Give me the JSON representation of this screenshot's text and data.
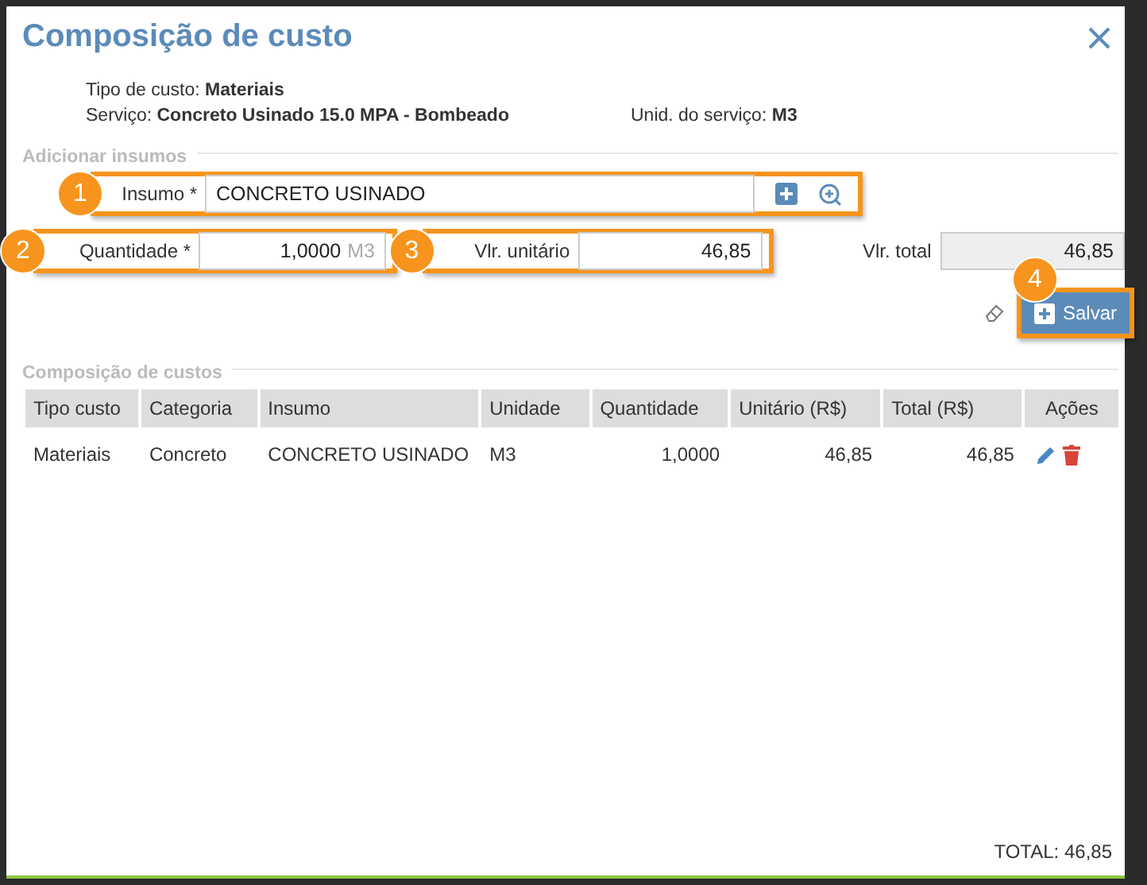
{
  "title": "Composição de custo",
  "info": {
    "cost_type_label": "Tipo de custo:",
    "cost_type": "Materiais",
    "service_label": "Serviço:",
    "service": "Concreto Usinado 15.0 MPA - Bombeado",
    "unit_label": "Unid. do serviço:",
    "unit": "M3"
  },
  "add_section": {
    "title": "Adicionar insumos",
    "insumo": {
      "callout": "1",
      "label": "Insumo *",
      "value": "CONCRETO USINADO"
    },
    "quantity": {
      "callout": "2",
      "label": "Quantidade *",
      "value": "1,0000",
      "unit": "M3"
    },
    "unit_value": {
      "callout": "3",
      "label": "Vlr. unitário",
      "value": "46,85"
    },
    "total_value": {
      "label": "Vlr. total",
      "value": "46,85"
    },
    "save": {
      "callout": "4",
      "label": "Salvar"
    }
  },
  "table": {
    "title": "Composição de custos",
    "columns": [
      "Tipo custo",
      "Categoria",
      "Insumo",
      "Unidade",
      "Quantidade",
      "Unitário (R$)",
      "Total (R$)",
      "Ações"
    ],
    "rows": [
      {
        "cells": [
          "Materiais",
          "Concreto",
          "CONCRETO USINADO",
          "M3",
          "1,0000",
          "46,85",
          "46,85"
        ]
      }
    ]
  },
  "total": "TOTAL: 46,85"
}
